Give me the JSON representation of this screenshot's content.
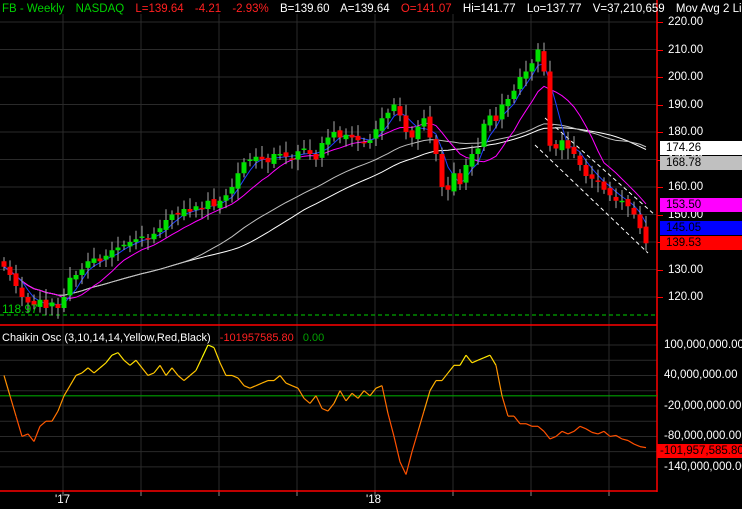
{
  "header": {
    "symbol": "FB - Weekly",
    "exchange": "NASDAQ",
    "last": "L=139.64",
    "change": "-4.21",
    "change_pct": "-2.93%",
    "bid": "B=139.60",
    "ask": "A=139.64",
    "open": "O=141.07",
    "high": "Hi=141.77",
    "low": "Lo=137.77",
    "volume": "V=37,210,659",
    "mov_avg": "Mov Avg 2 Li ..."
  },
  "price_axis": [
    "220.00",
    "210.00",
    "200.00",
    "190.00",
    "180.00",
    "170.00",
    "160.00",
    "150.00",
    "140.00",
    "130.00",
    "120.00"
  ],
  "price_tags": [
    {
      "label": "174.26",
      "value": 174.26,
      "bg": "#ffffff",
      "fg": "#000000"
    },
    {
      "label": "168.78",
      "value": 168.78,
      "bg": "#c0c0c0",
      "fg": "#000000"
    },
    {
      "label": "153.50",
      "value": 153.5,
      "bg": "#ff00ff",
      "fg": "#000000"
    },
    {
      "label": "145.05",
      "value": 145.05,
      "bg": "#0000ff",
      "fg": "#000000"
    },
    {
      "label": "139.53",
      "value": 139.53,
      "bg": "#ff0000",
      "fg": "#000000"
    }
  ],
  "low_marker": {
    "label": "118.97"
  },
  "x_axis": [
    "'17",
    "'18"
  ],
  "oscillator": {
    "title": "Chaikin Osc (3,10,14,14,Yellow,Red,Black)",
    "value": "-101957585.80",
    "zero": "0.00",
    "axis": [
      "100,000,000.00",
      "40,000,000.00",
      "-20,000,000.00",
      "-80,000,000.00",
      "-140,000,000.00"
    ],
    "current_tag": "-101,957,585.80"
  },
  "chart_data": {
    "type": "candlestick",
    "title": "FB - Weekly",
    "ylim": [
      110,
      225
    ],
    "closes": [
      131,
      128,
      124,
      120,
      118,
      117,
      119,
      116,
      118,
      116,
      120,
      127,
      128,
      130,
      133,
      134,
      133,
      135,
      137,
      138,
      139,
      140,
      141,
      142,
      141,
      143,
      145,
      148,
      150,
      150,
      152,
      151,
      153,
      152,
      155,
      153,
      155,
      157,
      160,
      165,
      169,
      170,
      171,
      170,
      169,
      172,
      172,
      171,
      170,
      173,
      174,
      172,
      170,
      176,
      178,
      180,
      178,
      179,
      178,
      177,
      176,
      177,
      181,
      185,
      187,
      190,
      186,
      180,
      178,
      182,
      185,
      178,
      172,
      160,
      159,
      165,
      161,
      168,
      172,
      174,
      183,
      186,
      184,
      190,
      192,
      195,
      200,
      202,
      205,
      210,
      202,
      175,
      174,
      177,
      174,
      172,
      168,
      164,
      163,
      162,
      159,
      157,
      155,
      155,
      153,
      150,
      145,
      139.53
    ],
    "oscillator_millions": [
      40,
      0,
      -40,
      -80,
      -75,
      -90,
      -60,
      -50,
      -50,
      -30,
      0,
      20,
      40,
      45,
      55,
      45,
      55,
      65,
      80,
      85,
      70,
      60,
      70,
      55,
      40,
      45,
      60,
      40,
      55,
      40,
      30,
      40,
      50,
      75,
      100,
      95,
      65,
      40,
      40,
      35,
      20,
      15,
      20,
      25,
      30,
      30,
      40,
      25,
      20,
      15,
      -5,
      -15,
      0,
      -25,
      -30,
      -15,
      10,
      -10,
      5,
      -5,
      10,
      0,
      15,
      20,
      -35,
      -80,
      -130,
      -155,
      -110,
      -70,
      -30,
      10,
      30,
      30,
      45,
      60,
      60,
      80,
      65,
      70,
      75,
      80,
      60,
      0,
      -40,
      -40,
      -55,
      -55,
      -60,
      -60,
      -70,
      -85,
      -80,
      -70,
      -75,
      -70,
      -60,
      -65,
      -72,
      -75,
      -70,
      -80,
      -78,
      -85,
      -88,
      -95,
      -100,
      -102
    ],
    "osc_ylim": [
      -160,
      120
    ]
  }
}
